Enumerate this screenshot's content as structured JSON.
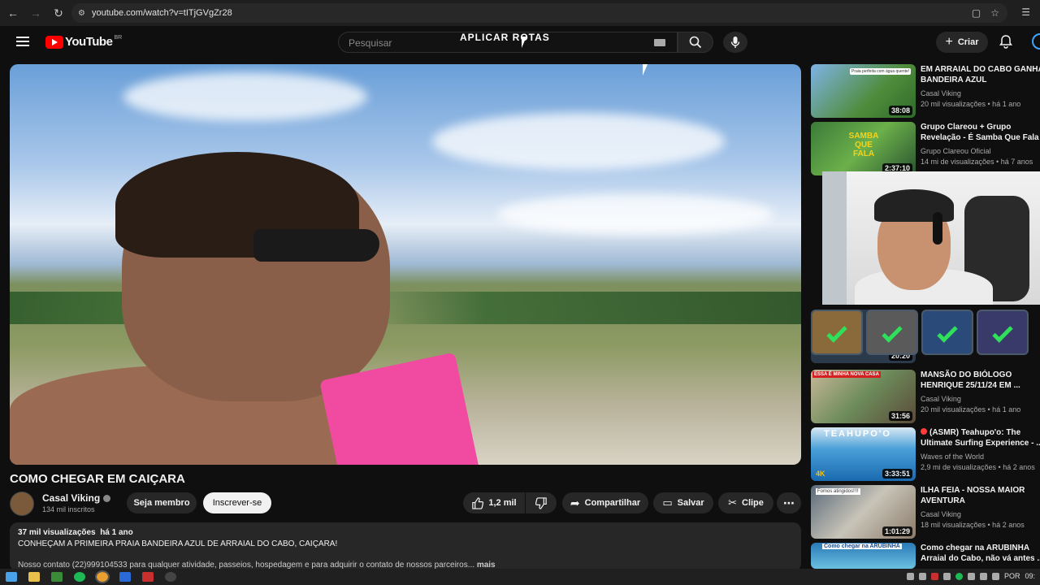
{
  "browser": {
    "url": "youtube.com/watch?v=tITjGVgZr28"
  },
  "header": {
    "logo_text": "YouTube",
    "country_code": "BR",
    "search_placeholder": "Pesquisar",
    "overlay_text": "APLICAR ROTAS",
    "create_label": "Criar"
  },
  "video": {
    "title": "COMO CHEGAR EM CAIÇARA",
    "channel": "Casal Viking",
    "subscribers": "134 mil inscritos",
    "member_label": "Seja membro",
    "subscribe_label": "Inscrever-se",
    "likes": "1,2 mil",
    "share_label": "Compartilhar",
    "save_label": "Salvar",
    "clip_label": "Clipe",
    "views": "37 mil visualizações",
    "age": "há 1 ano",
    "desc_line1": "CONHEÇAM A PRIMEIRA PRAIA BANDEIRA AZUL DE ARRAIAL DO CABO, CAIÇARA!",
    "desc_line2": "Nosso contato (22)999104533 para qualquer atividade, passeios, hospedagem e para adquirir o contato de nossos parceiros...",
    "more_label": "mais"
  },
  "sidebar": {
    "items": [
      {
        "title1": "EM ARRAIAL DO CABO GANHA",
        "title2": "BANDEIRA AZUL",
        "channel": "Casal Viking",
        "meta": "20 mil visualizações • há 1 ano",
        "duration": "38:08",
        "thumb_caption": "Praia perfeita com água quente!"
      },
      {
        "title1": "Grupo Clareou + Grupo",
        "title2": "Revelação - É Samba Que Fala",
        "channel": "Grupo Clareou Oficial",
        "meta": "14 mi de visualizações • há 7 anos",
        "duration": "2:37:10",
        "thumb_caption": "SAMBA QUE FALA"
      },
      {
        "title1": "",
        "title2": "",
        "channel": "",
        "meta": "",
        "duration": "20:20",
        "thumb_caption": ""
      },
      {
        "title1": "MANSÃO DO BIÓLOGO",
        "title2": "HENRIQUE 25/11/24 EM ...",
        "channel": "Casal Viking",
        "meta": "20 mil visualizações • há 1 ano",
        "duration": "31:56",
        "thumb_caption": "ESSA É MINHA NOVA CASA"
      },
      {
        "title1": "(ASMR) Teahupo'o: The",
        "title2": "Ultimate Surfing Experience - ...",
        "channel": "Waves of the World",
        "meta": "2,9 mi de visualizações • há 2 anos",
        "duration": "3:33:51",
        "thumb_caption": "TEAHUPO'O"
      },
      {
        "title1": "ILHA FEIA - NOSSA MAIOR",
        "title2": "AVENTURA",
        "channel": "Casal Viking",
        "meta": "18 mil visualizações • há 2 anos",
        "duration": "1:01:29",
        "thumb_caption": "Fomos atingidos!!!!"
      },
      {
        "title1": "Como chegar na ARUBINHA",
        "title2": "Arraial do Cabo, não vá antes ...",
        "channel": "",
        "meta": "",
        "duration": "",
        "thumb_caption": "Como chegar na ARUBINHA"
      }
    ]
  },
  "taskbar": {
    "language": "POR",
    "time": "09:"
  },
  "colors": {
    "background": "#0f0f0f",
    "accent_red": "#ff0000",
    "bag_pink": "#f04aa1",
    "check_green": "#2fe05a"
  }
}
